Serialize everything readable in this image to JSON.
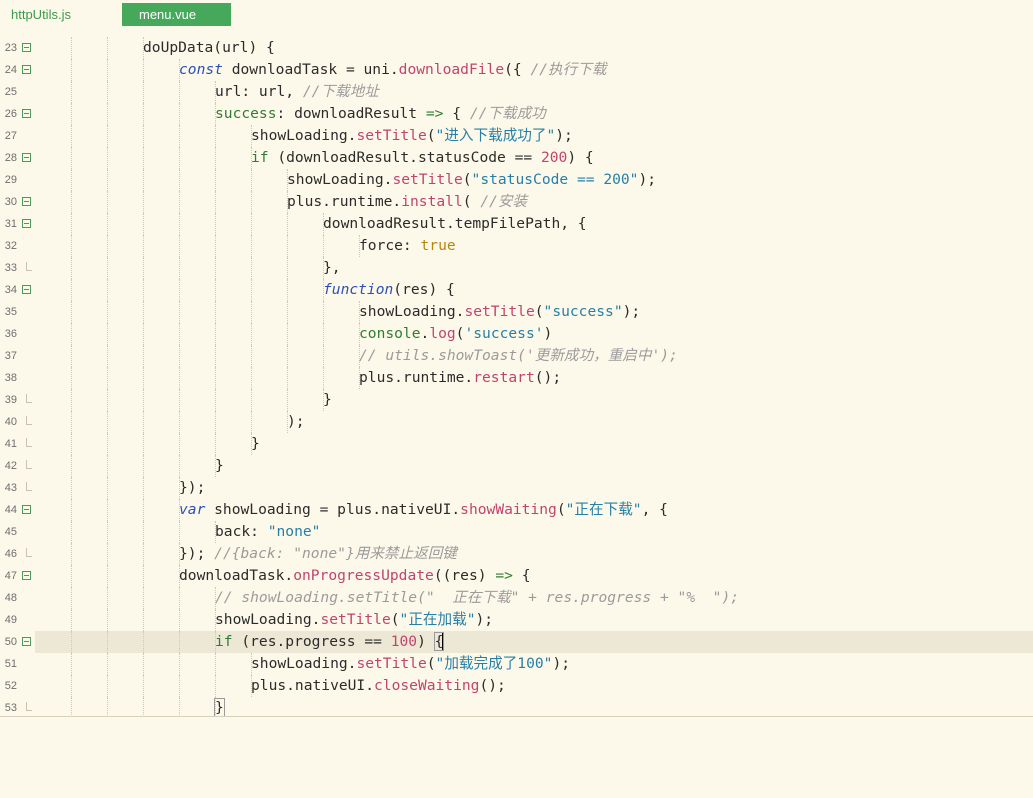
{
  "tabs": [
    {
      "label": "httpUtils.js",
      "active": false
    },
    {
      "label": "menu.vue",
      "active": true
    }
  ],
  "colors": {
    "background": "#fdf9ea",
    "active_tab": "#46a85a",
    "keyword": "#2f7d32",
    "function_call": "#c0446e",
    "string": "#267fa6",
    "comment": "#9b9b9b",
    "current_line": "#ece8d5"
  },
  "editor": {
    "current_line": 50,
    "lines": [
      {
        "n": "23",
        "indent": 3,
        "fold": "open",
        "tokens": [
          [
            "def",
            "doUpData"
          ],
          [
            "def",
            "(url) {"
          ]
        ]
      },
      {
        "n": "24",
        "indent": 4,
        "fold": "open",
        "tokens": [
          [
            "kwi",
            "const"
          ],
          [
            "def",
            " downloadTask = uni."
          ],
          [
            "fn",
            "downloadFile"
          ],
          [
            "def",
            "({ "
          ],
          [
            "com",
            "//执行下载"
          ]
        ]
      },
      {
        "n": "25",
        "indent": 5,
        "fold": "none",
        "tokens": [
          [
            "def",
            "url: url, "
          ],
          [
            "com",
            "//下载地址"
          ]
        ]
      },
      {
        "n": "26",
        "indent": 5,
        "fold": "open",
        "tokens": [
          [
            "kw",
            "success"
          ],
          [
            "def",
            ": downloadResult "
          ],
          [
            "kw",
            "=>"
          ],
          [
            "def",
            " { "
          ],
          [
            "com",
            "//下载成功"
          ]
        ]
      },
      {
        "n": "27",
        "indent": 6,
        "fold": "none",
        "tokens": [
          [
            "def",
            "showLoading."
          ],
          [
            "fn",
            "setTitle"
          ],
          [
            "def",
            "("
          ],
          [
            "str",
            "\"进入下载成功了\""
          ],
          [
            "def",
            ");"
          ]
        ]
      },
      {
        "n": "28",
        "indent": 6,
        "fold": "open",
        "tokens": [
          [
            "kw",
            "if"
          ],
          [
            "def",
            " (downloadResult.statusCode == "
          ],
          [
            "num",
            "200"
          ],
          [
            "def",
            ") {"
          ]
        ]
      },
      {
        "n": "29",
        "indent": 7,
        "fold": "none",
        "tokens": [
          [
            "def",
            "showLoading."
          ],
          [
            "fn",
            "setTitle"
          ],
          [
            "def",
            "("
          ],
          [
            "str",
            "\"statusCode == 200\""
          ],
          [
            "def",
            ");"
          ]
        ]
      },
      {
        "n": "30",
        "indent": 7,
        "fold": "open",
        "tokens": [
          [
            "def",
            "plus.runtime."
          ],
          [
            "fn",
            "install"
          ],
          [
            "def",
            "( "
          ],
          [
            "com",
            "//安装"
          ]
        ]
      },
      {
        "n": "31",
        "indent": 8,
        "fold": "open",
        "tokens": [
          [
            "def",
            "downloadResult.tempFilePath, {"
          ]
        ]
      },
      {
        "n": "32",
        "indent": 9,
        "fold": "none",
        "tokens": [
          [
            "def",
            "force: "
          ],
          [
            "bool",
            "true"
          ]
        ]
      },
      {
        "n": "33",
        "indent": 8,
        "fold": "end",
        "tokens": [
          [
            "def",
            "},"
          ]
        ]
      },
      {
        "n": "34",
        "indent": 8,
        "fold": "open",
        "tokens": [
          [
            "kwi",
            "function"
          ],
          [
            "def",
            "(res) {"
          ]
        ]
      },
      {
        "n": "35",
        "indent": 9,
        "fold": "none",
        "tokens": [
          [
            "def",
            "showLoading."
          ],
          [
            "fn",
            "setTitle"
          ],
          [
            "def",
            "("
          ],
          [
            "str",
            "\"success\""
          ],
          [
            "def",
            ");"
          ]
        ]
      },
      {
        "n": "36",
        "indent": 9,
        "fold": "none",
        "tokens": [
          [
            "kw",
            "console"
          ],
          [
            "def",
            "."
          ],
          [
            "fn",
            "log"
          ],
          [
            "def",
            "("
          ],
          [
            "str",
            "'success'"
          ],
          [
            "def",
            ")"
          ]
        ]
      },
      {
        "n": "37",
        "indent": 9,
        "fold": "none",
        "tokens": [
          [
            "com",
            "// utils.showToast('更新成功，重启中');"
          ]
        ]
      },
      {
        "n": "38",
        "indent": 9,
        "fold": "none",
        "tokens": [
          [
            "def",
            "plus.runtime."
          ],
          [
            "fn",
            "restart"
          ],
          [
            "def",
            "();"
          ]
        ]
      },
      {
        "n": "39",
        "indent": 8,
        "fold": "end",
        "tokens": [
          [
            "def",
            "}"
          ]
        ]
      },
      {
        "n": "40",
        "indent": 7,
        "fold": "end",
        "tokens": [
          [
            "def",
            ");"
          ]
        ]
      },
      {
        "n": "41",
        "indent": 6,
        "fold": "end",
        "tokens": [
          [
            "def",
            "}"
          ]
        ]
      },
      {
        "n": "42",
        "indent": 5,
        "fold": "end",
        "tokens": [
          [
            "def",
            "}"
          ]
        ]
      },
      {
        "n": "43",
        "indent": 4,
        "fold": "end",
        "tokens": [
          [
            "def",
            "});"
          ]
        ]
      },
      {
        "n": "44",
        "indent": 4,
        "fold": "open",
        "tokens": [
          [
            "kwi",
            "var"
          ],
          [
            "def",
            " showLoading = plus.nativeUI."
          ],
          [
            "fn",
            "showWaiting"
          ],
          [
            "def",
            "("
          ],
          [
            "str",
            "\"正在下载\""
          ],
          [
            "def",
            ", {"
          ]
        ]
      },
      {
        "n": "45",
        "indent": 5,
        "fold": "none",
        "tokens": [
          [
            "def",
            "back: "
          ],
          [
            "str",
            "\"none\""
          ]
        ]
      },
      {
        "n": "46",
        "indent": 4,
        "fold": "end",
        "tokens": [
          [
            "def",
            "}); "
          ],
          [
            "com",
            "//{back: \"none\"}用来禁止返回键"
          ]
        ]
      },
      {
        "n": "47",
        "indent": 4,
        "fold": "open",
        "tokens": [
          [
            "def",
            "downloadTask."
          ],
          [
            "fn",
            "onProgressUpdate"
          ],
          [
            "def",
            "((res) "
          ],
          [
            "kw",
            "=>"
          ],
          [
            "def",
            " {"
          ]
        ]
      },
      {
        "n": "48",
        "indent": 5,
        "fold": "none",
        "tokens": [
          [
            "com",
            "// showLoading.setTitle(\"  正在下载\" + res.progress + \"%  \");"
          ]
        ]
      },
      {
        "n": "49",
        "indent": 5,
        "fold": "none",
        "tokens": [
          [
            "def",
            "showLoading."
          ],
          [
            "fn",
            "setTitle"
          ],
          [
            "def",
            "("
          ],
          [
            "str",
            "\"正在加载\""
          ],
          [
            "def",
            ");"
          ]
        ]
      },
      {
        "n": "50",
        "indent": 5,
        "fold": "open",
        "tokens": [
          [
            "kw",
            "if"
          ],
          [
            "def",
            " (res.progress == "
          ],
          [
            "num",
            "100"
          ],
          [
            "def",
            ") "
          ],
          [
            "bracket",
            "{"
          ]
        ]
      },
      {
        "n": "51",
        "indent": 6,
        "fold": "none",
        "tokens": [
          [
            "def",
            "showLoading."
          ],
          [
            "fn",
            "setTitle"
          ],
          [
            "def",
            "("
          ],
          [
            "str",
            "\"加载完成了100\""
          ],
          [
            "def",
            ");"
          ]
        ]
      },
      {
        "n": "52",
        "indent": 6,
        "fold": "none",
        "tokens": [
          [
            "def",
            "plus.nativeUI."
          ],
          [
            "fn",
            "closeWaiting"
          ],
          [
            "def",
            "();"
          ]
        ]
      },
      {
        "n": "53",
        "indent": 5,
        "fold": "end",
        "tokens": [
          [
            "bracket",
            "}"
          ]
        ]
      }
    ]
  }
}
